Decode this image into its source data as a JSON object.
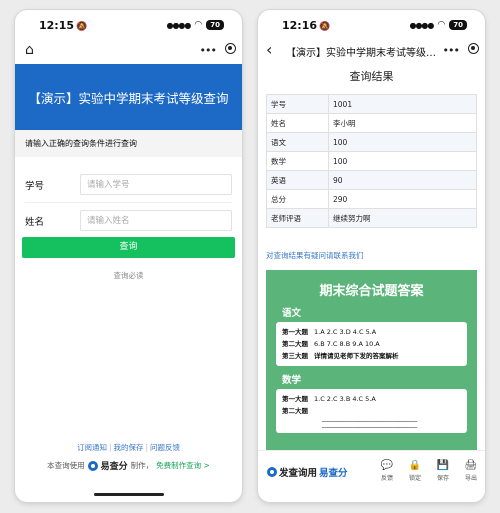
{
  "left": {
    "status": {
      "time": "12:15",
      "battery": "70"
    },
    "banner_title": "【演示】实验中学期末考试等级查询",
    "hint": "请输入正确的查询条件进行查询",
    "fields": [
      {
        "label": "学号",
        "placeholder": "请输入学号"
      },
      {
        "label": "姓名",
        "placeholder": "请输入姓名"
      }
    ],
    "query_button": "查询",
    "required_note": "查询必读",
    "footer_links": [
      "订阅通知",
      "我的保存",
      "问题反馈"
    ],
    "footer_prefix": "本查询使用",
    "brand": "易查分",
    "footer_mid": "制作，",
    "footer_free": "免费制作查询 >"
  },
  "right": {
    "status": {
      "time": "12:16",
      "battery": "70"
    },
    "nav_title": "【演示】实验中学期末考试等级查询",
    "result_title": "查询结果",
    "rows": [
      {
        "k": "学号",
        "v": "1001"
      },
      {
        "k": "姓名",
        "v": "李小明"
      },
      {
        "k": "语文",
        "v": "100"
      },
      {
        "k": "数学",
        "v": "100"
      },
      {
        "k": "英语",
        "v": "90"
      },
      {
        "k": "总分",
        "v": "290"
      },
      {
        "k": "老师评语",
        "v": "继续努力啊"
      }
    ],
    "feedback_link": "对查询结果有疑问请联系我们",
    "answer": {
      "title": "期末综合试题答案",
      "sec1": "语文",
      "sec1_lines": [
        {
          "h": "第一大题",
          "t": "1.A   2.C   3.D   4.C   5.A"
        },
        {
          "h": "第二大题",
          "t": "6.B   7.C   8.B   9.A   10.A"
        },
        {
          "h": "第三大题",
          "t": "详情请见老师下发的答案解析"
        }
      ],
      "sec2": "数学",
      "sec2_lines": [
        {
          "h": "第一大题",
          "t": "1.C   2.C   3.B   4.C   5.A"
        },
        {
          "h": "第二大题",
          "t": ""
        }
      ]
    },
    "footer_brand_prefix": "发查询用",
    "footer_brand": "易查分",
    "tools": [
      "反馈",
      "锁定",
      "保存",
      "导出"
    ]
  }
}
